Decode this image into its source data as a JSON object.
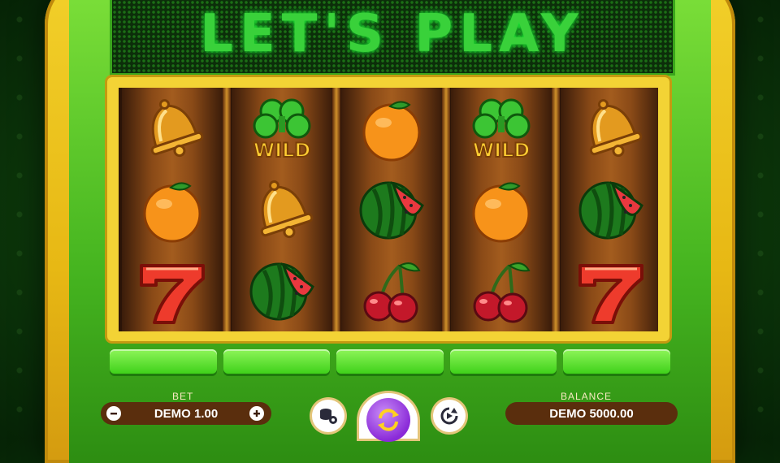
{
  "marquee": {
    "text": "LET'S PLAY"
  },
  "reels": [
    [
      "bell",
      "orange",
      "seven"
    ],
    [
      "clover-wild",
      "bell",
      "watermelon"
    ],
    [
      "orange",
      "watermelon",
      "cherries"
    ],
    [
      "clover-wild",
      "orange",
      "cherries"
    ],
    [
      "bell",
      "watermelon",
      "seven"
    ]
  ],
  "wild_label": "WILD",
  "controls": {
    "bet_label": "BET",
    "bet_value": "DEMO 1.00",
    "balance_label": "BALANCE",
    "balance_value": "DEMO 5000.00"
  },
  "colors": {
    "cabinet_gold": "#f2d02a",
    "cabinet_green": "#46b520",
    "marquee_text": "#39d13a",
    "spin_purple": "#8a2ad8"
  }
}
